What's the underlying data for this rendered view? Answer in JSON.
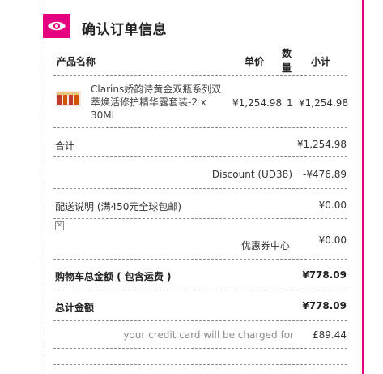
{
  "header": {
    "title": "确认订单信息",
    "icon": "eye-icon",
    "accent_color": "#e4007f"
  },
  "table": {
    "columns": {
      "product": "产品名称",
      "unit_price": "单价",
      "quantity": "数量",
      "subtotal": "小计"
    },
    "items": [
      {
        "name": "Clarins娇韵诗黄金双瓶系列双萃焕活修护精华露套装-2 x 30ML",
        "unit_price": "¥1,254.98",
        "quantity": "1",
        "subtotal": "¥1,254.98"
      }
    ]
  },
  "summary": {
    "subtotal_label": "合计",
    "subtotal_value": "¥1,254.98",
    "discount_label": "Discount (UD38)",
    "discount_value": "-¥476.89",
    "shipping_label": "配送说明 (满450元全球包邮)",
    "shipping_value": "¥0.00",
    "coupon_label": "优惠券中心",
    "coupon_value": "¥0.00",
    "cart_total_label": "购物车总金额 ( 包含运费 )",
    "cart_total_value": "¥778.09",
    "grand_total_label": "总计金额",
    "grand_total_value": "¥778.09",
    "charge_note": "your credit card will be charged for",
    "charge_value": "£89.44"
  }
}
